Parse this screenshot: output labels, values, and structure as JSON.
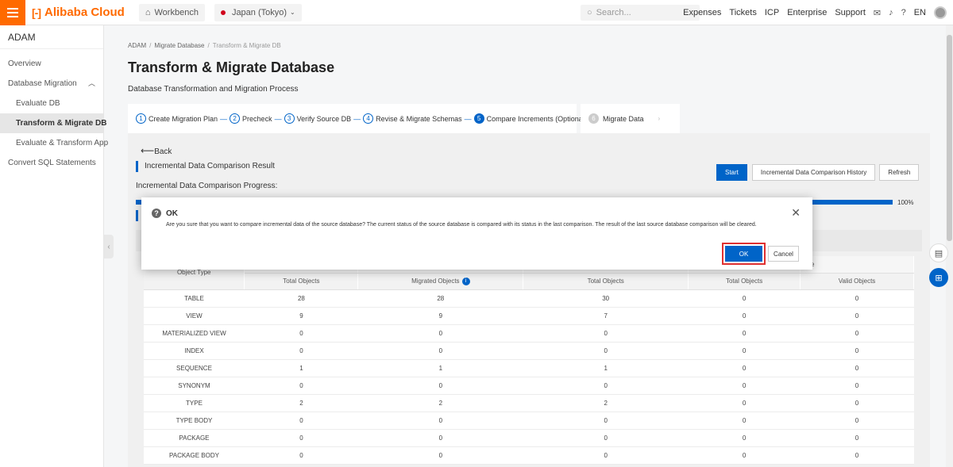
{
  "topbar": {
    "brand": "Alibaba Cloud",
    "workbench": "Workbench",
    "region": "Japan (Tokyo)",
    "search_placeholder": "Search...",
    "links": [
      "Expenses",
      "Tickets",
      "ICP",
      "Enterprise",
      "Support"
    ],
    "lang": "EN"
  },
  "sidebar": {
    "title": "ADAM",
    "items": [
      {
        "label": "Overview"
      },
      {
        "label": "Database Migration"
      },
      {
        "label": "Evaluate DB"
      },
      {
        "label": "Transform & Migrate DB"
      },
      {
        "label": "Evaluate & Transform App"
      },
      {
        "label": "Convert SQL Statements"
      }
    ]
  },
  "breadcrumb": [
    "ADAM",
    "Migrate Database",
    "Transform & Migrate DB"
  ],
  "page": {
    "title": "Transform & Migrate Database",
    "subtitle": "Database Transformation and Migration Process"
  },
  "steps": [
    {
      "num": "1",
      "label": "Create Migration Plan"
    },
    {
      "num": "2",
      "label": "Precheck"
    },
    {
      "num": "3",
      "label": "Verify Source DB"
    },
    {
      "num": "4",
      "label": "Revise & Migrate Schemas"
    },
    {
      "num": "5",
      "label": "Compare Increments (Optional)"
    },
    {
      "num": "6",
      "label": "Migrate Data"
    }
  ],
  "main": {
    "back": "Back",
    "section_title": "Incremental Data Comparison Result",
    "progress_label": "Incremental Data Comparison Progress:",
    "progress_value": 100,
    "progress_text": "100%",
    "buttons": {
      "start": "Start",
      "history": "Incremental Data Comparison History",
      "refresh": "Refresh"
    }
  },
  "table": {
    "first_col": "Object Type",
    "group_tail": "base",
    "headers": [
      "Total Objects",
      "Migrated Objects",
      "Total Objects",
      "Total Objects",
      "Valid Objects"
    ],
    "rows": [
      [
        "TABLE",
        "28",
        "28",
        "30",
        "0",
        "0"
      ],
      [
        "VIEW",
        "9",
        "9",
        "7",
        "0",
        "0"
      ],
      [
        "MATERIALIZED VIEW",
        "0",
        "0",
        "0",
        "0",
        "0"
      ],
      [
        "INDEX",
        "0",
        "0",
        "0",
        "0",
        "0"
      ],
      [
        "SEQUENCE",
        "1",
        "1",
        "1",
        "0",
        "0"
      ],
      [
        "SYNONYM",
        "0",
        "0",
        "0",
        "0",
        "0"
      ],
      [
        "TYPE",
        "2",
        "2",
        "2",
        "0",
        "0"
      ],
      [
        "TYPE BODY",
        "0",
        "0",
        "0",
        "0",
        "0"
      ],
      [
        "PACKAGE",
        "0",
        "0",
        "0",
        "0",
        "0"
      ],
      [
        "PACKAGE BODY",
        "0",
        "0",
        "0",
        "0",
        "0"
      ]
    ]
  },
  "modal": {
    "title": "OK",
    "message": "Are you sure that you want to compare incremental data of the source database? The current status of the source database is compared with its status in the last comparison. The result of the last source database comparison will be cleared.",
    "ok": "OK",
    "cancel": "Cancel"
  },
  "colors": {
    "accent": "#0064c8",
    "brand": "#ff6a00",
    "highlight": "#e03030"
  }
}
